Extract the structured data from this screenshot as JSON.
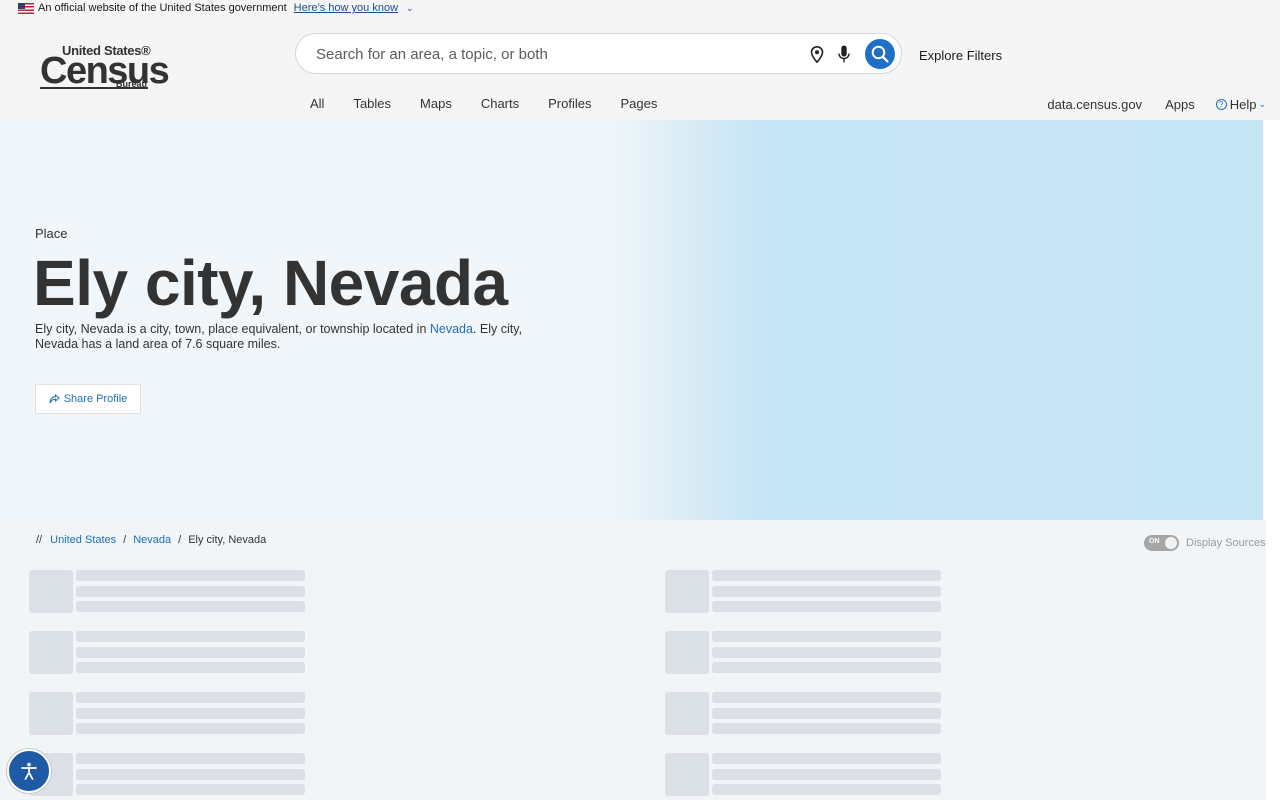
{
  "gov_banner": {
    "text": "An official website of the United States government",
    "link": "Here’s how you know"
  },
  "logo": {
    "line1": "United States®",
    "line2": "Census",
    "line3": "Bureau"
  },
  "search": {
    "placeholder": "Search for an area, a topic, or both"
  },
  "header": {
    "explore_filters": "Explore Filters"
  },
  "nav": {
    "items": [
      "All",
      "Tables",
      "Maps",
      "Charts",
      "Profiles",
      "Pages"
    ]
  },
  "right_nav": {
    "data_link": "data.census.gov",
    "apps": "Apps",
    "help": "Help"
  },
  "hero": {
    "type": "Place",
    "title": "Ely city, Nevada",
    "desc_before": "Ely city, Nevada is a city, town, place equivalent, or township located in ",
    "desc_link": "Nevada",
    "desc_after": ". Ely city, Nevada has a land area of 7.6 square miles.",
    "share_label": "Share Profile"
  },
  "breadcrumb": {
    "root": "//",
    "items": [
      "United States",
      "Nevada",
      "Ely city, Nevada"
    ],
    "sep": "/"
  },
  "sources": {
    "toggle_state": "ON",
    "label": "Display Sources"
  },
  "colors": {
    "accent": "#1e6fc7",
    "hero_bg": "#f0f6fa",
    "map_bg": "#c5e4f4",
    "skeleton": "#dbe0e6",
    "a11y_bg": "#1e5aa6"
  },
  "icons": [
    "us-flag-icon",
    "chevron-down-icon",
    "location-pin-icon",
    "microphone-icon",
    "search-icon",
    "help-circle-icon",
    "share-icon",
    "accessibility-icon"
  ]
}
